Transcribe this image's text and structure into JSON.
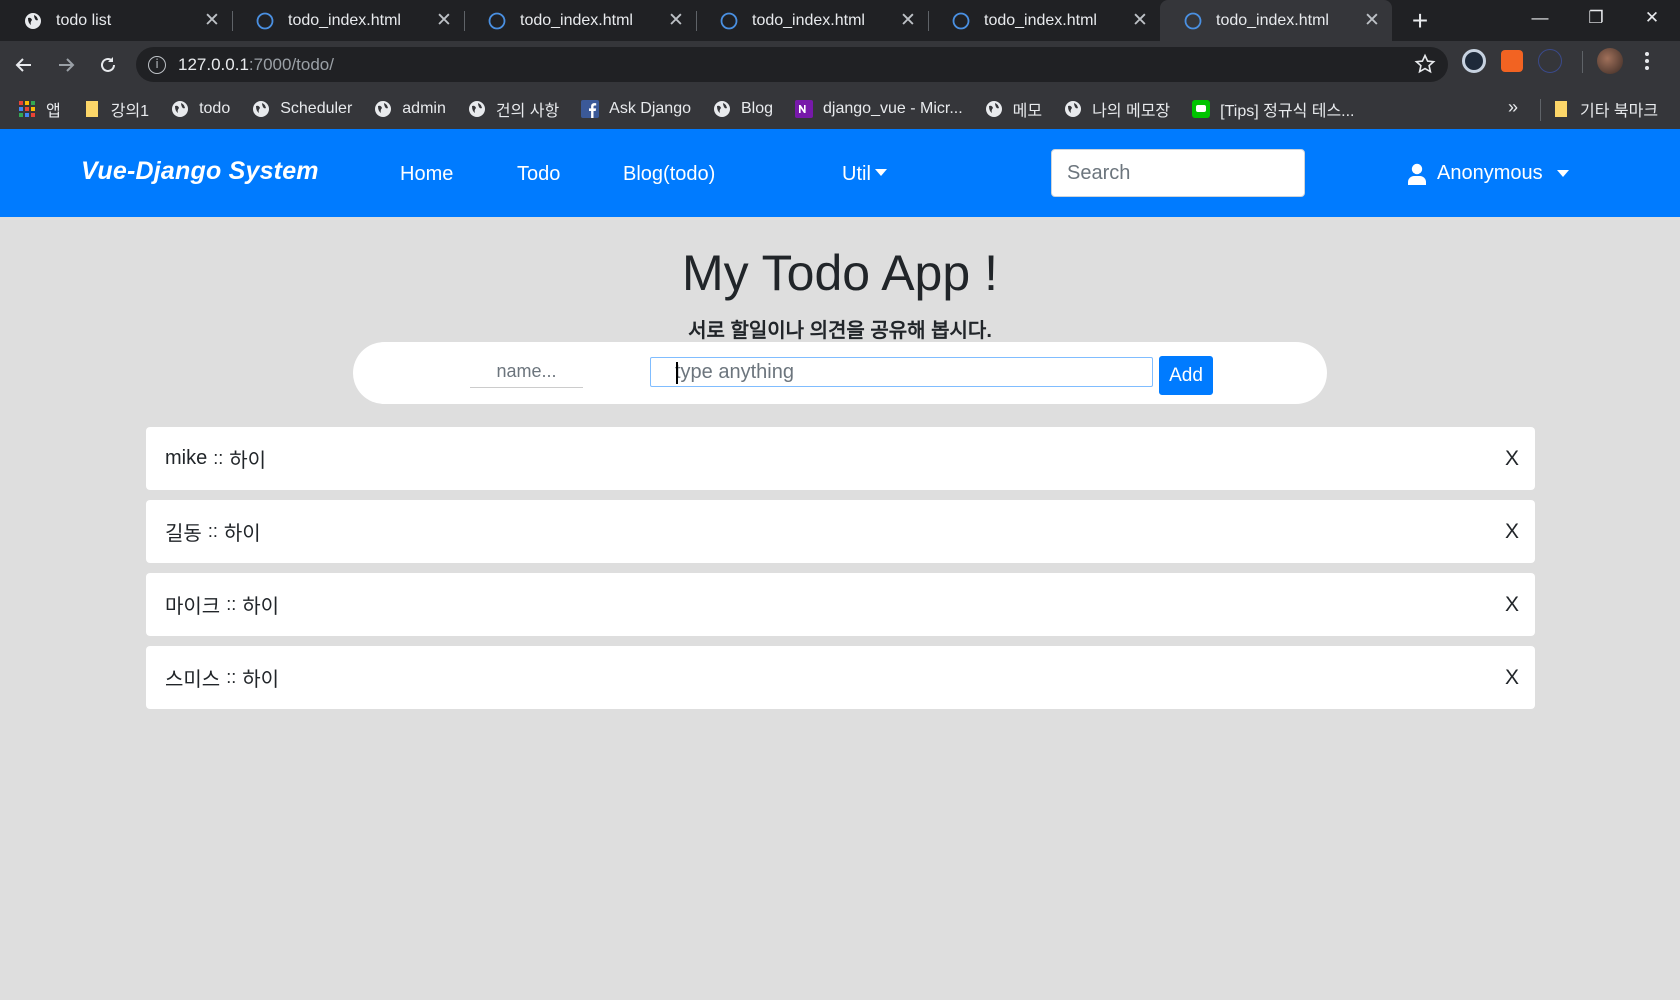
{
  "browser": {
    "tabs": [
      {
        "title": "todo list",
        "icon": "globe-icon",
        "active": false
      },
      {
        "title": "todo_index.html",
        "icon": "loading-icon",
        "active": false
      },
      {
        "title": "todo_index.html",
        "icon": "loading-icon",
        "active": false
      },
      {
        "title": "todo_index.html",
        "icon": "loading-icon",
        "active": false
      },
      {
        "title": "todo_index.html",
        "icon": "loading-icon",
        "active": false
      },
      {
        "title": "todo_index.html",
        "icon": "loading-icon",
        "active": true
      }
    ],
    "tab_close": "✕",
    "new_tab": "+",
    "window": {
      "minimize": "—",
      "restore": "❐",
      "close": "✕"
    },
    "url_host": "127.0.0.1",
    "url_rest": ":7000/todo/",
    "bookmarks": [
      {
        "label": "앱",
        "icon": "apps-grid-icon"
      },
      {
        "label": "강의1",
        "icon": "folder-icon"
      },
      {
        "label": "todo",
        "icon": "globe-icon"
      },
      {
        "label": "Scheduler",
        "icon": "globe-icon"
      },
      {
        "label": "admin",
        "icon": "globe-icon"
      },
      {
        "label": "건의 사항",
        "icon": "globe-icon"
      },
      {
        "label": "Ask Django",
        "icon": "facebook-icon"
      },
      {
        "label": "Blog",
        "icon": "globe-icon"
      },
      {
        "label": "django_vue - Micr...",
        "icon": "onenote-icon"
      },
      {
        "label": "메모",
        "icon": "globe-icon"
      },
      {
        "label": "나의 메모장",
        "icon": "globe-icon"
      },
      {
        "label": "[Tips] 정규식 테스...",
        "icon": "line-icon"
      }
    ],
    "bookmarks_more": "»",
    "other_bookmarks": "기타 북마크",
    "colors": {
      "chrome_dark": "#202124",
      "chrome": "#35363a"
    }
  },
  "navbar": {
    "brand": "Vue-Django System",
    "links": [
      "Home",
      "Todo",
      "Blog(todo)"
    ],
    "util": "Util",
    "search_placeholder": "Search",
    "user": "Anonymous",
    "color": "#007bff"
  },
  "main": {
    "title": "My Todo App !",
    "subtitle": "서로 할일이나 의견을 공유해 봅시다.",
    "name_placeholder": "name...",
    "todo_placeholder": "type anything",
    "add_label": "Add",
    "todos": [
      {
        "name": "mike",
        "sep": "::",
        "text": "하이",
        "delete": "X"
      },
      {
        "name": "길동",
        "sep": "::",
        "text": "하이",
        "delete": "X"
      },
      {
        "name": "마이크",
        "sep": "::",
        "text": "하이",
        "delete": "X"
      },
      {
        "name": "스미스",
        "sep": "::",
        "text": "하이",
        "delete": "X"
      }
    ]
  }
}
